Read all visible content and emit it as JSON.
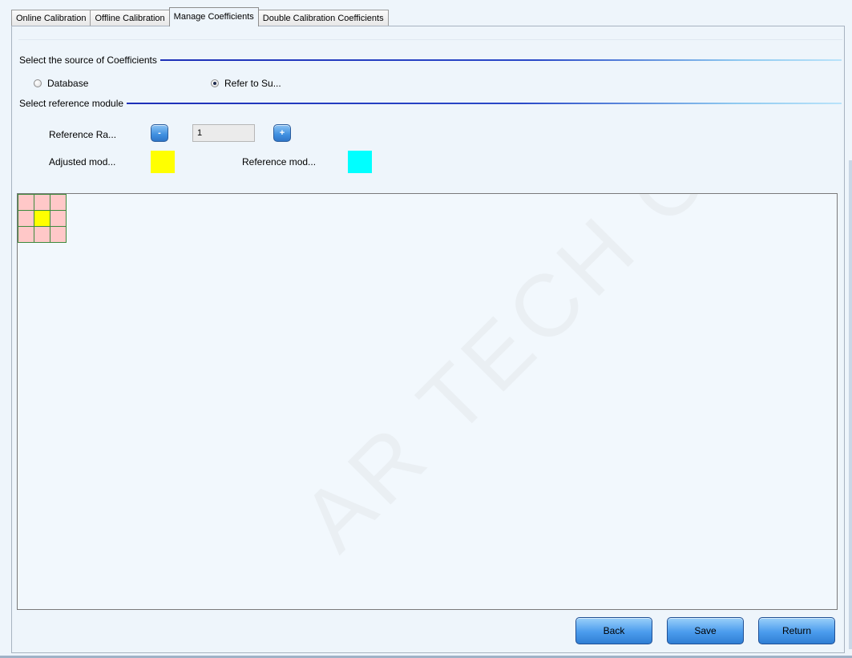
{
  "tabs": [
    {
      "label": "Online Calibration",
      "active": false
    },
    {
      "label": "Offline Calibration",
      "active": false
    },
    {
      "label": "Manage Coefficients",
      "active": true
    },
    {
      "label": "Double Calibration Coefficients",
      "active": false
    }
  ],
  "source_section": {
    "title": "Select the source of Coefficients",
    "options": [
      {
        "label": "Database",
        "checked": false
      },
      {
        "label": "Refer to Su...",
        "checked": true
      }
    ]
  },
  "reference_section": {
    "title": "Select reference module",
    "range_label": "Reference Ra...",
    "range_value": "1",
    "decrement_symbol": "-",
    "increment_symbol": "+",
    "adjusted_label": "Adjusted mod...",
    "adjusted_color": "#ffff00",
    "reference_label": "Reference mod...",
    "reference_color": "#00ffff"
  },
  "module_grid": {
    "rows": 3,
    "cols": 3,
    "cell_color": "#ffc8c8",
    "center_color": "#ffff00",
    "border_color": "#3d8a3d"
  },
  "watermark": "AR TECH CO.,LTD.",
  "footer": {
    "back_label": "Back",
    "save_label": "Save",
    "return_label": "Return"
  }
}
